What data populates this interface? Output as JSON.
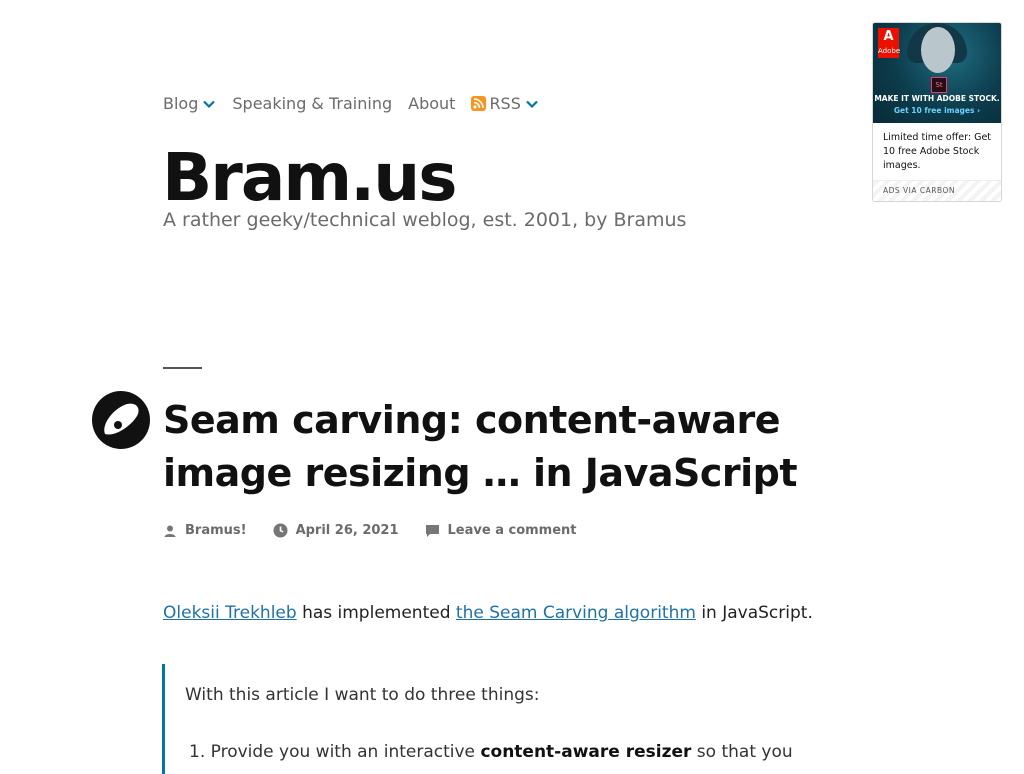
{
  "nav": {
    "items": [
      {
        "label": "Blog",
        "has_dropdown": true
      },
      {
        "label": "Speaking & Training",
        "has_dropdown": false
      },
      {
        "label": "About",
        "has_dropdown": false
      },
      {
        "label": "RSS",
        "has_dropdown": true,
        "icon": "rss-icon"
      }
    ]
  },
  "site": {
    "title": "Bram.us",
    "tagline": "A rather geeky/technical weblog, est. 2001, by Bramus"
  },
  "ad": {
    "brand": "Adobe",
    "badge": "St",
    "headline": "MAKE IT WITH ADOBE STOCK.",
    "subline": "Get 10 free images ›",
    "text": "Limited time offer: Get 10 free Adobe Stock images.",
    "footer": "ADS VIA CARBON"
  },
  "post": {
    "title": "Seam carving: content-aware image resizing … in JavaScript",
    "meta": {
      "author": "Bramus!",
      "date": "April 26, 2021",
      "comments": "Leave a comment"
    },
    "intro": {
      "link1": "Oleksii Trekhleb",
      "text1": " has implemented ",
      "link2": "the Seam Carving algorithm",
      "text2": " in JavaScript."
    },
    "quote": {
      "lead": "With this article I want to do three things:",
      "item1_prefix": "1. Provide you with an interactive ",
      "item1_bold": "content-aware resizer",
      "item1_suffix": " so that you"
    }
  },
  "colors": {
    "accent": "#0073aa",
    "link": "#1f72a8",
    "rss": "#f7941d"
  }
}
